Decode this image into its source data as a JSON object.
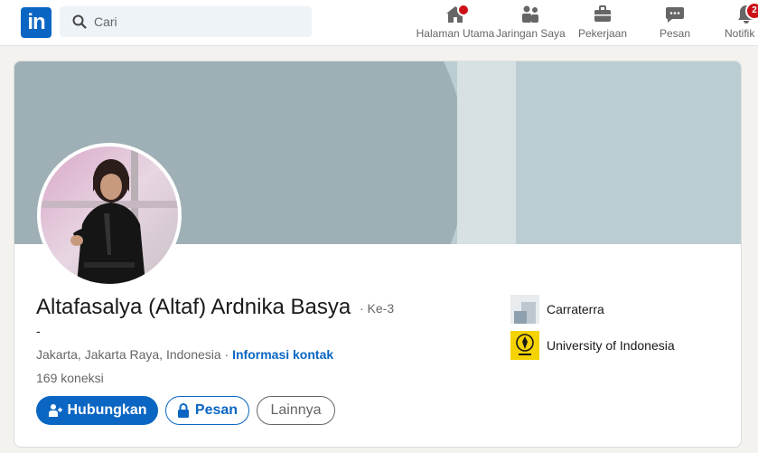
{
  "nav": {
    "logo_text": "in",
    "search": {
      "placeholder": "Cari"
    },
    "items": [
      {
        "label": "Halaman Utama",
        "icon": "home-icon",
        "badge": ""
      },
      {
        "label": "Jaringan Saya",
        "icon": "network-icon",
        "badge": ""
      },
      {
        "label": "Pekerjaan",
        "icon": "briefcase-icon",
        "badge": ""
      },
      {
        "label": "Pesan",
        "icon": "messaging-icon",
        "badge": ""
      },
      {
        "label": "Notifik",
        "icon": "bell-icon",
        "badge": "2"
      }
    ]
  },
  "profile": {
    "name": "Altafasalya (Altaf) Ardnika Basya",
    "degree": "· Ke-3",
    "headline": "-",
    "location": "Jakarta, Jakarta Raya, Indonesia · ",
    "contact_link": "Informasi kontak",
    "connections": "169 koneksi",
    "buttons": {
      "connect": "Hubungkan",
      "message": "Pesan",
      "more": "Lainnya"
    },
    "affiliations": [
      {
        "name": "Carraterra"
      },
      {
        "name": "University of Indonesia"
      }
    ]
  },
  "colors": {
    "brand": "#0a66c2",
    "notification_badge": "#cc1016",
    "cover": "#bccdd2"
  }
}
